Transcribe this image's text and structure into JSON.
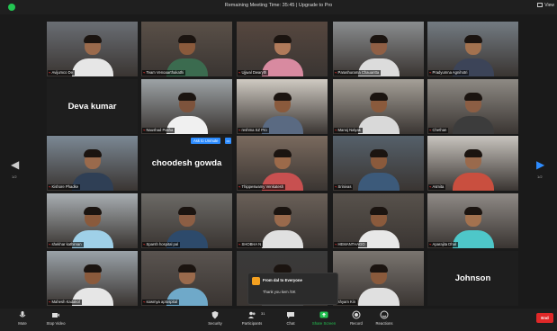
{
  "topbar": {
    "meeting_time": "Remaining Meeting Time: 35:45 | Upgrade to Pro",
    "view_label": "View"
  },
  "tiles_row1": [
    {
      "name": "Avijumco De",
      "bg": "#6a6e74",
      "skin": "#9a6a4c",
      "shirt": "#e6e6e6"
    },
    {
      "name": "Team Venoaarthakathi",
      "bg": "#5a5048",
      "skin": "#8a5a3c",
      "shirt": "#3b6b4f"
    },
    {
      "name": "Ujjwal Dwaryth",
      "bg": "#56473f",
      "skin": "#b07a5a",
      "shirt": "#d88aa0"
    },
    {
      "name": "Parashurama Chauantta",
      "bg": "#8a8d8f",
      "skin": "#8f5f45",
      "shirt": "#dcdcdc"
    },
    {
      "name": "Pradyumna Agnihotri",
      "bg": "#737b82",
      "skin": "#a3724f",
      "shirt": "#3c4458"
    }
  ],
  "tiles_row2": [
    {
      "name": "Deva kumar",
      "text_only": true
    },
    {
      "name": "Naushad Pasha",
      "bg": "#9da3a6",
      "skin": "#7d533c",
      "shirt": "#f0f0f0"
    },
    {
      "name": "reshma SZ Pro",
      "bg": "#cfcac2",
      "skin": "#8a5a3c",
      "shirt": "#5a6a82"
    },
    {
      "name": "Manoj Nalyak",
      "bg": "#a5a098",
      "skin": "#8a5a3c",
      "shirt": "#d9d9d9"
    },
    {
      "name": "Chethan",
      "bg": "#8e8a84",
      "skin": "#8c5e44",
      "shirt": "#3c3c3c"
    }
  ],
  "tiles_row3": [
    {
      "name": "Kishore Phadke",
      "bg": "#7b8894",
      "skin": "#9a6a4c",
      "shirt": "#2f3f55"
    },
    {
      "name": "choodesh gowda",
      "text_only": true
    },
    {
      "name": "Thippeswamy Venkatesh",
      "bg": "#7a6a5e",
      "skin": "#9c6a4a",
      "shirt": "#c85050"
    },
    {
      "name": "Srinivas",
      "bg": "#55606a",
      "skin": "#8a5a3c",
      "shirt": "#3c5a7a"
    },
    {
      "name": "Asmita",
      "bg": "#c8c4be",
      "skin": "#9a6a4c",
      "shirt": "#c94f3f"
    }
  ],
  "tiles_row4": [
    {
      "name": "shekhar kathirvan",
      "bg": "#a8aeb2",
      "skin": "#8a5a3c",
      "shirt": "#9fd0e8"
    },
    {
      "name": "Sparsh hospital pal",
      "bg": "#6c6a66",
      "skin": "#8c5e44",
      "shirt": "#2d4a6b"
    },
    {
      "name": "SHOBHA N",
      "bg": "#6a6058",
      "skin": "#9a6a4c",
      "shirt": "#e0e0e0"
    },
    {
      "name": "HEMANTHAGO",
      "bg": "#58524c",
      "skin": "#8a5a3c",
      "shirt": "#e8e8e8"
    },
    {
      "name": "Aparajita Dhal",
      "bg": "#8f8a86",
      "skin": "#a3724f",
      "shirt": "#4ec7c9"
    }
  ],
  "tiles_row5": [
    {
      "name": "Mahesh Kadakol",
      "bg": "#9aa2a8",
      "skin": "#8a5a3c",
      "shirt": "#e6e6e6"
    },
    {
      "name": "sowmya aptospital",
      "bg": "#5a5450",
      "skin": "#9a6a4c",
      "shirt": "#6fa9c9"
    },
    {
      "name": "",
      "bg": "#3a3a3a",
      "skin": "#9a6a4c",
      "shirt": "#4a4a4a"
    },
    {
      "name": "shyam Kin",
      "bg": "#7a7570",
      "skin": "#8a5a3c",
      "shirt": "#e0e0e0"
    },
    {
      "name": "Johnson",
      "text_only": true
    }
  ],
  "overlays": {
    "ask_to_unmute": "Ask to Unmute",
    "chat_from": "From dal to Everyone",
    "chat_message": "Thank you kem /SK"
  },
  "nav": {
    "page_left": "1/2",
    "page_right": "1/2"
  },
  "toolbar": {
    "mute": "Mute",
    "stop_video": "Stop Video",
    "security": "Security",
    "participants": "Participants",
    "participants_count": "31",
    "chat": "Chat",
    "share_screen": "Share Screen",
    "record": "Record",
    "reactions": "Reactions",
    "end": "End"
  },
  "colors": {
    "accent": "#2d8cff",
    "share_green": "#23c552",
    "end_red": "#e02828",
    "active_speaker": "#b6ff3b"
  }
}
